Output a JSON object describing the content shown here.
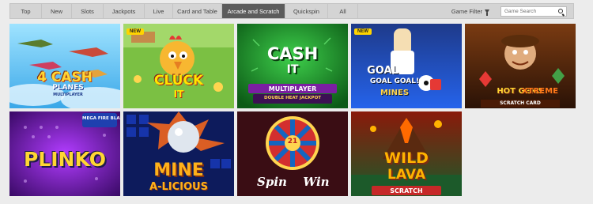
{
  "nav": {
    "tabs": [
      {
        "label": "Top",
        "width": 40
      },
      {
        "label": "New",
        "width": 38
      },
      {
        "label": "Slots",
        "width": 40
      },
      {
        "label": "Jackpots",
        "width": 52
      },
      {
        "label": "Live",
        "width": 36
      },
      {
        "label": "Card and Table",
        "width": 62
      },
      {
        "label": "Arcade and Scratch",
        "width": 80,
        "active": true
      },
      {
        "label": "Quickspin",
        "width": 54
      },
      {
        "label": "All",
        "width": 38
      }
    ],
    "filter_label": "Game Filter",
    "search_placeholder": "Game Search"
  },
  "games": [
    {
      "title_line1": "4 CASH",
      "title_line2": "PLANES",
      "subtitle": "MULTIPLAYER",
      "badge": ""
    },
    {
      "title_line1": "CLUCK",
      "title_line2": "IT",
      "subtitle": "",
      "badge": "NEW"
    },
    {
      "title_line1": "CASH",
      "title_line2": "IT",
      "subtitle": "MULTIPLAYER",
      "extra": "DOUBLE HEAT JACKPOT",
      "badge": ""
    },
    {
      "title_line1": "GOAL",
      "title_line2": "GOAL GOAL!",
      "subtitle": "MINES",
      "badge": "NEW"
    },
    {
      "title_line1": "HOT GEMS",
      "title_line2": "XTREME",
      "subtitle": "SCRATCH CARD",
      "badge": ""
    },
    {
      "title_line1": "PLINKO",
      "title_line2": "",
      "subtitle": "MEGA FIRE BLAZE",
      "badge": ""
    },
    {
      "title_line1": "MINE",
      "title_line2": "A-LICIOUS",
      "subtitle": "",
      "badge": ""
    },
    {
      "title_line1": "Spin",
      "title_line2": "Win",
      "subtitle": "21",
      "badge": ""
    },
    {
      "title_line1": "WILD",
      "title_line2": "LAVA",
      "subtitle": "SCRATCH",
      "badge": ""
    }
  ]
}
